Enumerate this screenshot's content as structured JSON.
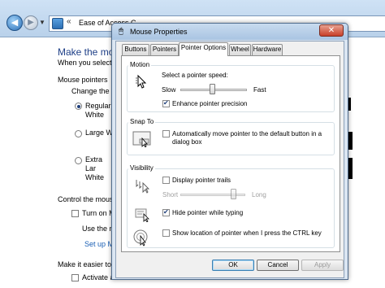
{
  "background_window": {
    "address_text": "Ease of Access C",
    "address_separator": "«",
    "page_title": "Make the mous",
    "page_subtitle": "When you select th",
    "mouse_pointers_heading": "Mouse pointers",
    "change_color_label": "Change the c",
    "scheme_regular": "Regular White",
    "scheme_large": "Large Wh",
    "scheme_extra_large": "Extra Lar White",
    "control_heading": "Control the mouse",
    "turn_on_label": "Turn on M",
    "use_numeric_label": "Use the nu",
    "setup_link": "Set up M",
    "easier_heading": "Make it easier to s",
    "activate_label": "Activate a"
  },
  "dialog": {
    "title": "Mouse Properties",
    "close_glyph": "✕",
    "tabs": [
      {
        "label": "Buttons",
        "active": false
      },
      {
        "label": "Pointers",
        "active": false
      },
      {
        "label": "Pointer Options",
        "active": true
      },
      {
        "label": "Wheel",
        "active": false
      },
      {
        "label": "Hardware",
        "active": false
      }
    ],
    "motion": {
      "heading": "Motion",
      "speed_label": "Select a pointer speed:",
      "slow_label": "Slow",
      "fast_label": "Fast",
      "speed_level": 0.5,
      "precision_label": "Enhance pointer precision",
      "precision_checked": true
    },
    "snap_to": {
      "heading": "Snap To",
      "auto_move_label": "Automatically move pointer to the default button in a dialog box",
      "auto_move_line1": "Automatically move pointer to the default button in a",
      "auto_move_line2": "dialog box",
      "auto_move_checked": false
    },
    "visibility": {
      "heading": "Visibility",
      "trails_label": "Display pointer trails",
      "trails_checked": false,
      "short_label": "Short",
      "long_label": "Long",
      "trail_level": 0.85,
      "hide_typing_label": "Hide pointer while typing",
      "hide_typing_checked": true,
      "show_location_label": "Show location of pointer when I press the CTRL key",
      "show_location_checked": false
    },
    "buttons": {
      "ok": "OK",
      "cancel": "Cancel",
      "apply": "Apply"
    }
  },
  "icons": {
    "back": "back-arrow-icon",
    "forward": "forward-arrow-icon",
    "address": "control-panel-icon",
    "mouse": "mouse-icon",
    "motion": "pointer-motion-icon",
    "snap": "snap-to-icon",
    "trails": "pointer-trails-icon",
    "hide": "hide-pointer-icon",
    "locate": "locate-pointer-icon"
  },
  "colors": {
    "title_blue": "#1e3f87",
    "link_blue": "#1a5fb4",
    "default_button_border": "#3c7fb1"
  }
}
